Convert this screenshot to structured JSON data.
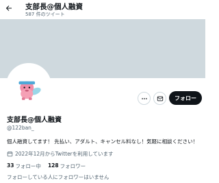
{
  "header": {
    "title": "支部長@個人融資",
    "tweet_count": "587 件のツイート"
  },
  "profile": {
    "name": "支部長@個人融資",
    "handle": "@122ban_",
    "bio": "個人融資してます！ 先払い、アダルト、キャンセル料なし！気軽に相談ください！",
    "joined": "2022年12月からTwitterを利用しています",
    "following_count": "33",
    "following_label": "フォロー中",
    "followers_count": "128",
    "followers_label": "フォロワー",
    "followers_note": "フォローしている人にフォロワーはいません"
  },
  "actions": {
    "follow_label": "フォロー"
  },
  "colors": {
    "banner": "#cfd9de",
    "follow_button": "#0f1419",
    "secondary_text": "#536471"
  },
  "icons": {
    "back": "arrow-left-icon",
    "more": "more-dots-icon",
    "message": "envelope-icon",
    "joined": "calendar-icon"
  }
}
